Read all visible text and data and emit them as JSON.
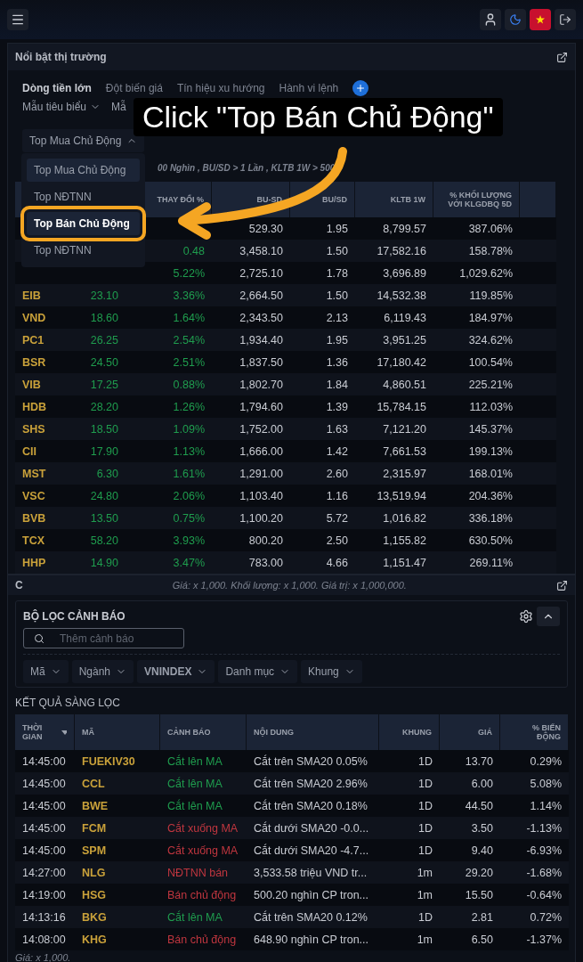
{
  "market_panel": {
    "title": "Nổi bật thị trường",
    "tabs": [
      {
        "label": "Dòng tiền lớn",
        "selected": true
      },
      {
        "label": "Đột biến giá",
        "selected": false
      },
      {
        "label": "Tín hiệu xu hướng",
        "selected": false
      },
      {
        "label": "Hành vi lệnh",
        "selected": false
      }
    ],
    "filters": [
      {
        "label": "Mẫu tiêu biểu",
        "caret": true
      },
      {
        "label": "Mẫ",
        "caret": false
      }
    ],
    "select": {
      "value": "Top Mua Chủ Động",
      "expanded": true
    },
    "menu": [
      {
        "label": "Top Mua Chủ Động",
        "selected": true,
        "callout_target": false
      },
      {
        "label": "Top NĐTNN",
        "selected": false,
        "callout_target": false
      },
      {
        "label": "Top Bán Chủ Động",
        "selected": false,
        "callout_target": true
      },
      {
        "label": "Top NĐTNN",
        "selected": false,
        "callout_target": false
      }
    ],
    "criteria": "00 Nghìn , BU/SD > 1 Lần , KLTB 1W > 500",
    "columns": [
      "",
      "",
      "THAY ĐỔI %",
      "BU-SD",
      "BU/SD",
      "KLTB 1W",
      "% KHỐI LƯỢNG VỚI KLGDBQ 5D"
    ],
    "rows": [
      [
        "",
        "",
        "",
        "529.30",
        "1.95",
        "8,799.57",
        "387.06%"
      ],
      [
        "",
        "",
        "0.48",
        "3,458.10",
        "1.50",
        "17,582.16",
        "158.78%"
      ],
      [
        "",
        "",
        "5.22%",
        "2,725.10",
        "1.78",
        "3,696.89",
        "1,029.62%"
      ],
      [
        "EIB",
        "23.10",
        "3.36%",
        "2,664.50",
        "1.50",
        "14,532.38",
        "119.85%"
      ],
      [
        "VND",
        "18.60",
        "1.64%",
        "2,343.50",
        "2.13",
        "6,119.43",
        "184.97%"
      ],
      [
        "PC1",
        "26.25",
        "2.54%",
        "1,934.40",
        "1.95",
        "3,951.25",
        "324.62%"
      ],
      [
        "BSR",
        "24.50",
        "2.51%",
        "1,837.50",
        "1.36",
        "17,180.42",
        "100.54%"
      ],
      [
        "VIB",
        "17.25",
        "0.88%",
        "1,802.70",
        "1.84",
        "4,860.51",
        "225.21%"
      ],
      [
        "HDB",
        "28.20",
        "1.26%",
        "1,794.60",
        "1.39",
        "15,784.15",
        "112.03%"
      ],
      [
        "SHS",
        "18.50",
        "1.09%",
        "1,752.00",
        "1.63",
        "7,121.20",
        "145.37%"
      ],
      [
        "CII",
        "17.90",
        "1.13%",
        "1,666.00",
        "1.42",
        "7,661.53",
        "199.13%"
      ],
      [
        "MST",
        "6.30",
        "1.61%",
        "1,291.00",
        "2.60",
        "2,315.97",
        "168.01%"
      ],
      [
        "VSC",
        "24.80",
        "2.06%",
        "1,103.40",
        "1.16",
        "13,519.94",
        "204.36%"
      ],
      [
        "BVB",
        "13.50",
        "0.75%",
        "1,100.20",
        "5.72",
        "1,016.82",
        "336.18%"
      ],
      [
        "TCX",
        "58.20",
        "3.93%",
        "800.20",
        "2.50",
        "1,155.82",
        "630.50%"
      ],
      [
        "HHP",
        "14.90",
        "3.47%",
        "783.00",
        "4.66",
        "1,151.47",
        "269.11%"
      ]
    ],
    "footnote": "Giá: x 1,000. Khối lượng: x 1,000. Giá trị: x 1,000,000."
  },
  "callout": "Click \"Top Bán Chủ Động\"",
  "alert_panel": {
    "title": "C",
    "filter_card": {
      "title": "BỘ LỌC CẢNH BÁO",
      "expanded": true,
      "search_placeholder": "Thêm cảnh báo",
      "chips": [
        {
          "label": "Mã",
          "bold": false
        },
        {
          "label": "Ngành",
          "bold": false
        },
        {
          "label": "VNINDEX",
          "bold": true
        },
        {
          "label": "Danh mục",
          "bold": false
        },
        {
          "label": "Khung",
          "bold": false
        }
      ]
    },
    "results_title": "KẾT QUẢ SÀNG LỌC",
    "columns": [
      "THỜI GIAN",
      "MÃ",
      "CẢNH BÁO",
      "NỘI DUNG",
      "KHUNG",
      "GIÁ",
      "% BIẾN ĐỘNG"
    ],
    "rows": [
      {
        "time": "14:45:00",
        "code": "FUEKIV30",
        "alert": "Cắt lên MA",
        "color": "#1f9d4e",
        "content": "Cắt trên SMA20 0.05%",
        "frame": "1D",
        "price": "13.70",
        "change": "0.29%"
      },
      {
        "time": "14:45:00",
        "code": "CCL",
        "alert": "Cắt lên MA",
        "color": "#1f9d4e",
        "content": "Cắt trên SMA20 2.96%",
        "frame": "1D",
        "price": "6.00",
        "change": "5.08%"
      },
      {
        "time": "14:45:00",
        "code": "BWE",
        "alert": "Cắt lên MA",
        "color": "#1f9d4e",
        "content": "Cắt trên SMA20 0.18%",
        "frame": "1D",
        "price": "44.50",
        "change": "1.14%"
      },
      {
        "time": "14:45:00",
        "code": "FCM",
        "alert": "Cắt xuống MA",
        "color": "#c0363f",
        "content": "Cắt dưới SMA20 -0.0...",
        "frame": "1D",
        "price": "3.50",
        "change": "-1.13%"
      },
      {
        "time": "14:45:00",
        "code": "SPM",
        "alert": "Cắt xuống MA",
        "color": "#c0363f",
        "content": "Cắt dưới SMA20 -4.7...",
        "frame": "1D",
        "price": "9.40",
        "change": "-6.93%"
      },
      {
        "time": "14:27:00",
        "code": "NLG",
        "alert": "NĐTNN bán",
        "color": "#c0363f",
        "content": "3,533.58 triệu VND tr...",
        "frame": "1m",
        "price": "29.20",
        "change": "-1.68%"
      },
      {
        "time": "14:19:00",
        "code": "HSG",
        "alert": "Bán chủ động",
        "color": "#c0363f",
        "content": "500.20 nghìn CP tron...",
        "frame": "1m",
        "price": "15.50",
        "change": "-0.64%"
      },
      {
        "time": "14:13:16",
        "code": "BKG",
        "alert": "Cắt lên MA",
        "color": "#1f9d4e",
        "content": "Cắt trên SMA20 0.12%",
        "frame": "1D",
        "price": "2.81",
        "change": "0.72%"
      },
      {
        "time": "14:08:00",
        "code": "KHG",
        "alert": "Bán chủ động",
        "color": "#c0363f",
        "content": "648.90 nghìn CP tron...",
        "frame": "1m",
        "price": "6.50",
        "change": "-1.37%"
      }
    ],
    "footnote": "Giá: x 1,000."
  }
}
